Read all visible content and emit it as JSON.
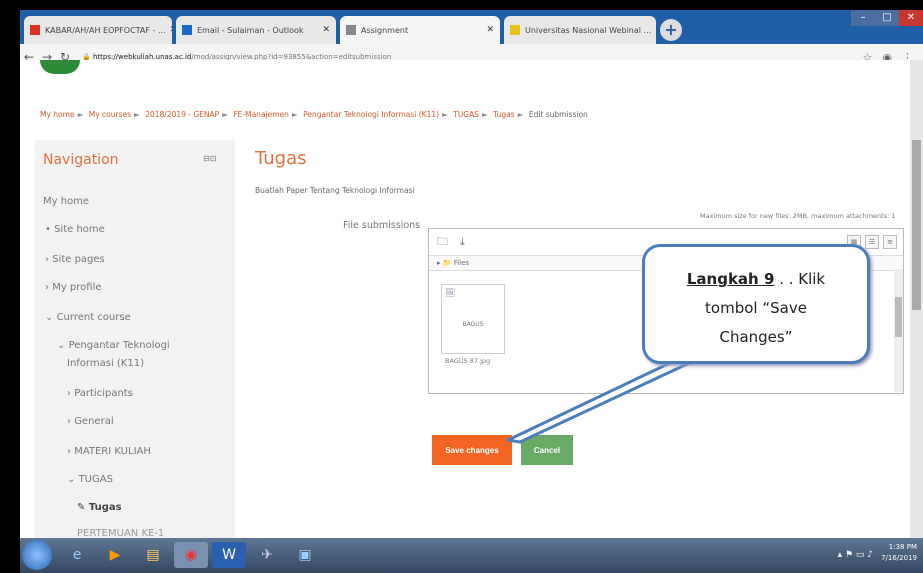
{
  "browser": {
    "tabs": [
      {
        "label": "KABAR/AH/AH EOPFOCTAF - ..."
      },
      {
        "label": "Email - Sulaiman - Outlook"
      },
      {
        "label": "Assignment"
      },
      {
        "label": "Universitas Nasional Webinal ..."
      }
    ],
    "url_host": "https://webkuliah.unas.ac.id",
    "url_path": "/mod/assign/view.php?id=93855&action=editsubmission"
  },
  "breadcrumb": [
    "My home",
    "My courses",
    "2018/2019 - GENAP",
    "FE-Manajemen",
    "Pengantar Teknologi Informasi (K11)",
    "TUGAS",
    "Tugas",
    "Edit submission"
  ],
  "sidebar": {
    "title": "Navigation",
    "items": {
      "my_home": "My home",
      "site_home": "Site home",
      "site_pages": "Site pages",
      "my_profile": "My profile",
      "current_course": "Current course",
      "course_name": "Pengantar Teknologi",
      "course_name2": "Informasi (K11)",
      "participants": "Participants",
      "general": "General",
      "materi": "MATERI KULIAH",
      "tugas": "TUGAS",
      "tugas_item": "Tugas",
      "cutoff": "PERTEMUAN KE-1"
    }
  },
  "content": {
    "title": "Tugas",
    "description": "Buatlah Paper Tentang Teknologi Informasi",
    "file_label": "File submissions",
    "max_note": "Maximum size for new files: 2MB, maximum attachments: 1",
    "path": "Files",
    "file_thumb_text": "BAGUS",
    "file_name": "BAGUS 87.jpg",
    "save_label": "Save changes",
    "cancel_label": "Cancel"
  },
  "callout": {
    "bold": "Langkah 9",
    "line1_rest": ". . Klik",
    "line2": "tombol “Save",
    "line3": "Changes”"
  },
  "taskbar": {
    "time": "1:38 PM",
    "date": "7/16/2019"
  }
}
